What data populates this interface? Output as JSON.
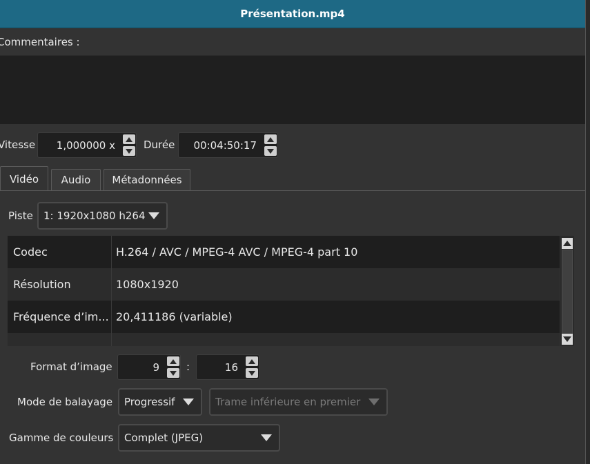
{
  "window": {
    "title": "Présentation.mp4"
  },
  "comments": {
    "label": "Commentaires :",
    "value": ""
  },
  "speed": {
    "label": "Vitesse",
    "value": "1,000000 x"
  },
  "duration": {
    "label": "Durée",
    "value": "00:04:50:17"
  },
  "tabs": [
    {
      "label": "Vidéo",
      "active": true
    },
    {
      "label": "Audio",
      "active": false
    },
    {
      "label": "Métadonnées",
      "active": false
    }
  ],
  "track": {
    "label": "Piste",
    "value": "1: 1920x1080 h264"
  },
  "properties": [
    {
      "key": "Codec",
      "value": "H.264 / AVC / MPEG-4 AVC / MPEG-4 part 10"
    },
    {
      "key": "Résolution",
      "value": "1080x1920"
    },
    {
      "key": "Fréquence d’im...",
      "value": "20,411186 (variable)"
    },
    {
      "key": "",
      "value": ""
    }
  ],
  "aspect": {
    "label": "Format d’image",
    "num": "9",
    "sep": ":",
    "den": "16"
  },
  "scan": {
    "label": "Mode de balayage",
    "value": "Progressif",
    "field_order": "Trame inférieure en premier"
  },
  "color_range": {
    "label": "Gamme de couleurs",
    "value": "Complet (JPEG)"
  },
  "colors": {
    "titlebar": "#1e6985",
    "background": "#333333",
    "field": "#1f1f1f"
  }
}
